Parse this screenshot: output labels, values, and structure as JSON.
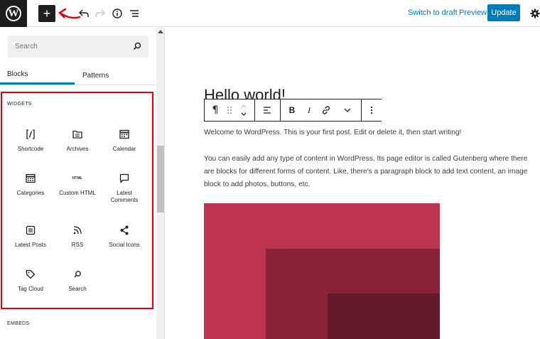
{
  "topbar": {
    "logo_letter": "W",
    "switch_to_draft": "Switch to draft",
    "preview": "Preview",
    "update": "Update",
    "annotation_color": "#e10000",
    "accent_color": "#007cba"
  },
  "sidebar": {
    "search": {
      "placeholder": "Search"
    },
    "tabs": [
      {
        "label": "Blocks",
        "active": true
      },
      {
        "label": "Patterns",
        "active": false
      }
    ],
    "categories": [
      {
        "label": "WIDGETS",
        "items": [
          {
            "label": "Shortcode",
            "icon": "shortcode-icon"
          },
          {
            "label": "Archives",
            "icon": "archives-icon"
          },
          {
            "label": "Calendar",
            "icon": "calendar-icon"
          },
          {
            "label": "Categories",
            "icon": "categories-icon"
          },
          {
            "label": "Custom HTML",
            "icon": "html-icon",
            "icon_text": "HTML"
          },
          {
            "label": "Latest Comments",
            "icon": "comment-icon"
          },
          {
            "label": "Latest Posts",
            "icon": "latest-posts-icon"
          },
          {
            "label": "RSS",
            "icon": "rss-icon"
          },
          {
            "label": "Social Icons",
            "icon": "share-icon"
          },
          {
            "label": "Tag Cloud",
            "icon": "tag-icon"
          },
          {
            "label": "Search",
            "icon": "search-icon"
          }
        ]
      },
      {
        "label": "EMBEDS"
      }
    ]
  },
  "editor": {
    "title": "Hello world!",
    "paragraphs": [
      "Welcome to WordPress. This is your first post. Edit or delete it, then start writing!",
      "You can easily add any type of content in WordPress. Its page editor is called Gutenberg where there are blocks for different forms of content. Like, there's a paragraph block to add text content, an image block to add photos, buttons, etc."
    ],
    "cover_colors": [
      "#be3551",
      "#8a2238",
      "#641a2b"
    ]
  }
}
